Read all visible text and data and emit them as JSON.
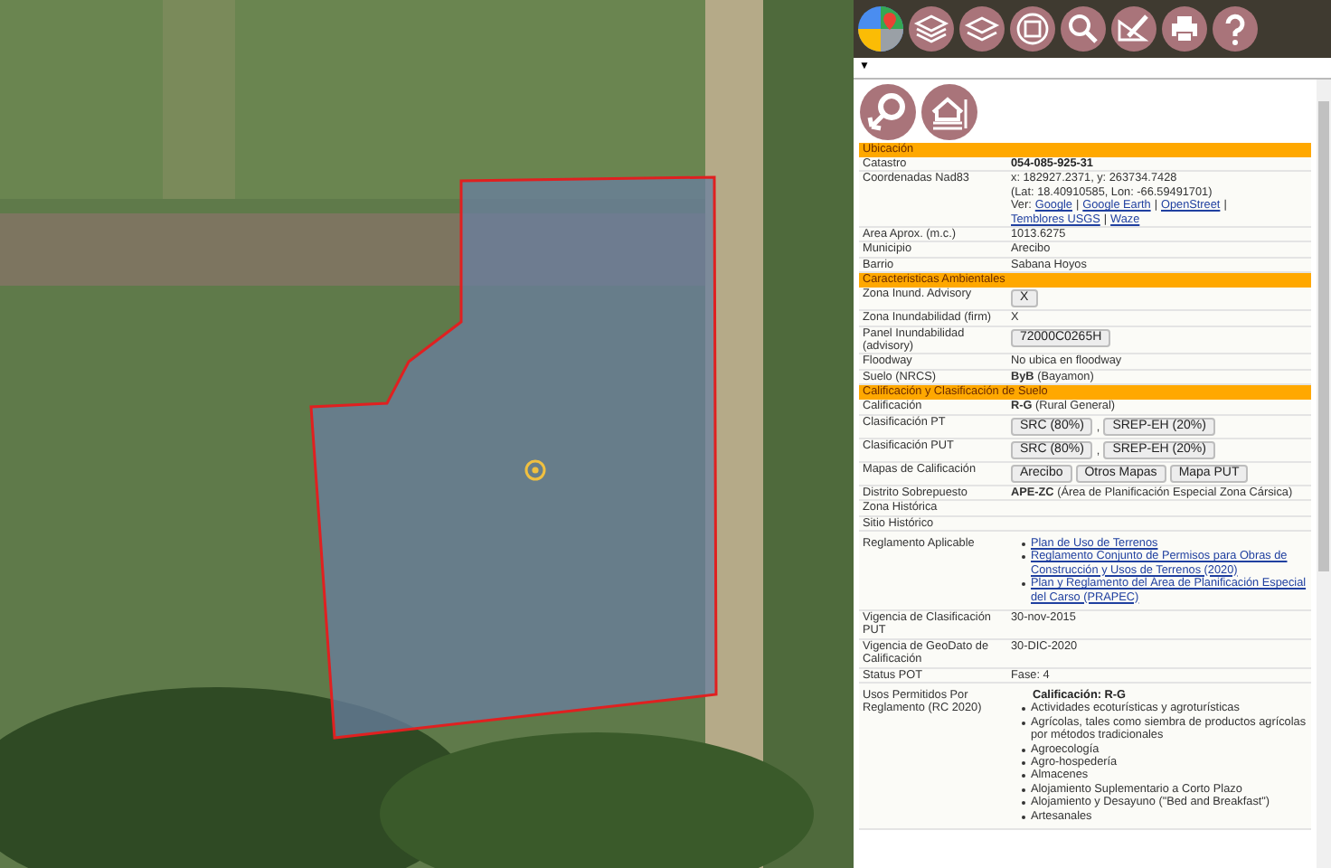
{
  "panel": {
    "caret": "▼"
  },
  "sections": [
    {
      "title": "Ubicación",
      "rows": [
        {
          "label": "Catastro",
          "kind": "strong",
          "value": "054-085-925-31"
        },
        {
          "label": "Coordenadas Nad83",
          "kind": "coords",
          "lines": [
            "x: 182927.2371, y: 263734.7428",
            "(Lat: 18.40910585, Lon: -66.59491701)"
          ],
          "prefix": "Ver:",
          "separator": "|",
          "links": [
            "Google",
            "Google Earth",
            "OpenStreet",
            "Temblores USGS",
            "Waze"
          ]
        },
        {
          "label": "Area Aprox. (m.c.)",
          "kind": "text",
          "value": "1013.6275"
        },
        {
          "label": "Municipio",
          "kind": "text",
          "value": "Arecibo"
        },
        {
          "label": "Barrio",
          "kind": "text",
          "value": "Sabana Hoyos"
        }
      ]
    },
    {
      "title": "Caracteristicas Ambientales",
      "rows": [
        {
          "label": "Zona Inund. Advisory",
          "kind": "buttons",
          "buttons": [
            "X"
          ]
        },
        {
          "label": "Zona Inundabilidad (firm)",
          "kind": "text",
          "value": "X"
        },
        {
          "label": "Panel Inundabilidad (advisory)",
          "kind": "buttons",
          "buttons": [
            "72000C0265H"
          ]
        },
        {
          "label": "Floodway",
          "kind": "text",
          "value": "No ubica en floodway"
        },
        {
          "label": "Suelo (NRCS)",
          "kind": "text",
          "value": "**ByB** (Bayamon)"
        }
      ]
    },
    {
      "title": "Calificación y Clasificación de Suelo",
      "rows": [
        {
          "label": "Calificación",
          "kind": "text",
          "value": "**R-G** (Rural General)"
        },
        {
          "label": "Clasificación PT",
          "kind": "buttons",
          "buttons": [
            "SRC (80%)",
            "SREP-EH (20%)"
          ],
          "separator": ","
        },
        {
          "label": "Clasificación PUT",
          "kind": "buttons",
          "buttons": [
            "SRC (80%)",
            "SREP-EH (20%)"
          ],
          "separator": ","
        },
        {
          "label": "Mapas de Calificación",
          "kind": "buttons",
          "buttons": [
            "Arecibo",
            "Otros Mapas",
            "Mapa PUT"
          ]
        },
        {
          "label": "Distrito Sobrepuesto",
          "kind": "text",
          "value": "**APE-ZC** (Área de Planificación Especial Zona Cársica)"
        },
        {
          "label": "Zona Histórica",
          "kind": "text"
        },
        {
          "label": "Sitio Histórico",
          "kind": "text"
        },
        {
          "label": "Reglamento Aplicable",
          "kind": "links",
          "links": [
            "Plan de Uso de Terrenos",
            "Reglamento Conjunto de Permisos para Obras de Construcción y Usos de Terrenos (2020)",
            "Plan y Reglamento del Área de Planificación Especial del Carso (PRAPEC)"
          ]
        },
        {
          "label": "Vigencia de Clasificación PUT",
          "kind": "text",
          "value": "30-nov-2015"
        },
        {
          "label": "Vigencia de GeoDato de Calificación",
          "kind": "text",
          "value": "30-DIC-2020"
        },
        {
          "label": "Status POT",
          "kind": "text",
          "value": "Fase: 4"
        },
        {
          "label": "Usos Permitidos Por Reglamento (RC 2020)",
          "kind": "list",
          "heading": "Calificación: R-G",
          "items": [
            "Actividades ecoturísticas y agroturísticas",
            "Agrícolas, tales como siembra de productos agrícolas por métodos tradicionales",
            "Agroecología",
            "Agro-hospedería",
            "Almacenes",
            "Alojamiento Suplementario a Corto Plazo",
            "Alojamiento y Desayuno (\"Bed and Breakfast\")",
            "Artesanales"
          ]
        }
      ]
    }
  ]
}
